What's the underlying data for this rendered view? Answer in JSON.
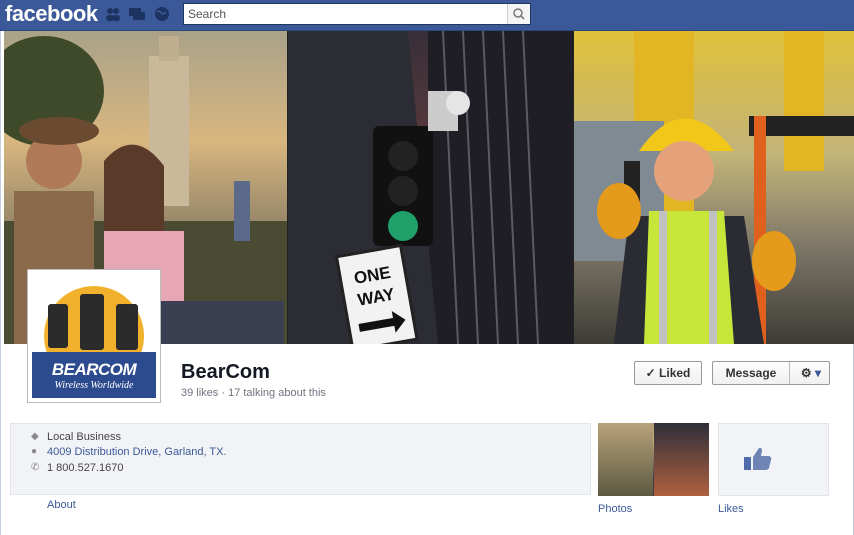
{
  "topbar": {
    "logo": "facebook",
    "search_placeholder": "Search",
    "icons": [
      "friend-requests-icon",
      "messages-icon",
      "notifications-globe-icon",
      "search-icon"
    ]
  },
  "page": {
    "name": "BearCom",
    "stats": "39 likes · 17 talking about this",
    "profile_brand": "BEARCOM",
    "profile_tagline": "Wireless Worldwide",
    "liked_label": "Liked",
    "message_label": "Message"
  },
  "info": {
    "category": "Local Business",
    "address": "4009 Distribution Drive, Garland, TX.",
    "phone": "1 800.527.1670"
  },
  "tabs": {
    "about": "About",
    "photos": "Photos",
    "likes": "Likes"
  },
  "colors": {
    "brand_blue": "#3b5998",
    "page_bg": "#e9ebee"
  }
}
